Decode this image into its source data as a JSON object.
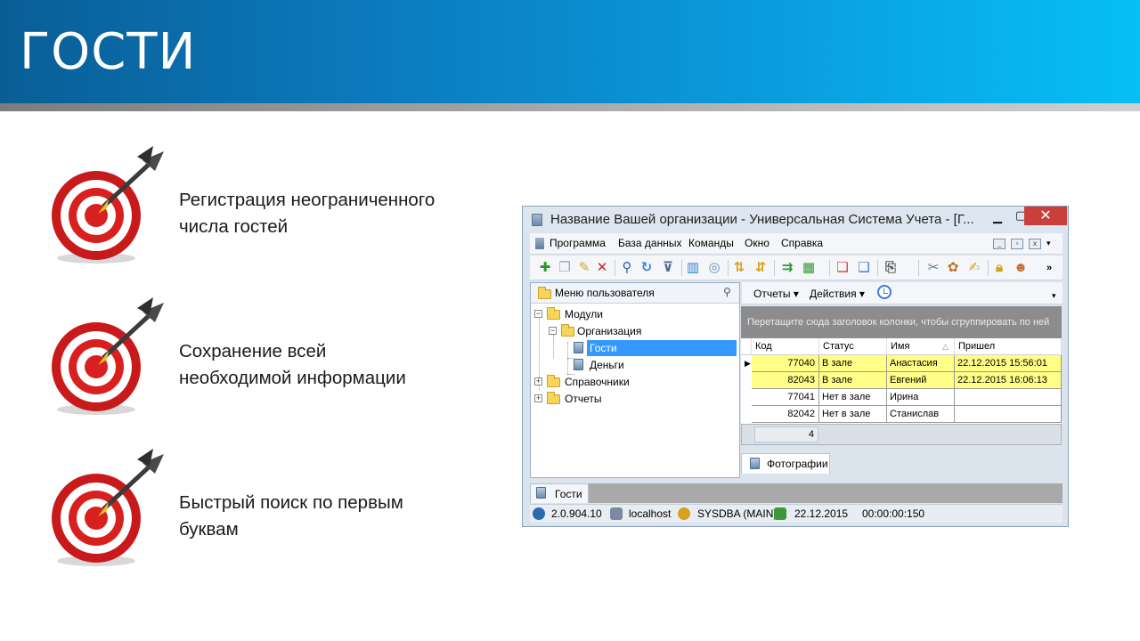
{
  "slide": {
    "title": "ГОСТИ",
    "features": [
      {
        "line1": "Регистрация неограниченного",
        "line2": "числа гостей"
      },
      {
        "line1": "Сохранение всей",
        "line2": "необходимой информации"
      },
      {
        "line1": "Быстрый поиск по первым",
        "line2": "буквам"
      }
    ]
  },
  "window": {
    "title": "Название Вашей организации - Универсальная Система Учета - [Г...",
    "menu": [
      "Программа",
      "База данных",
      "Команды",
      "Окно",
      "Справка"
    ],
    "left_panel": {
      "title": "Меню пользователя",
      "tree": {
        "modules": "Модули",
        "organization": "Организация",
        "guests": "Гости",
        "money": "Деньги",
        "directories": "Справочники",
        "reports": "Отчеты"
      }
    },
    "right_toolbar": {
      "reports": "Отчеты",
      "actions": "Действия"
    },
    "group_hint": "Перетащите сюда заголовок колонки, чтобы сгруппировать по ней",
    "grid": {
      "columns": [
        "Код",
        "Статус",
        "Имя",
        "Пришел"
      ],
      "rows": [
        {
          "code": "77040",
          "status": "В зале",
          "name": "Анастасия",
          "arrived": "22.12.2015 15:56:01"
        },
        {
          "code": "82043",
          "status": "В зале",
          "name": "Евгений",
          "arrived": "22.12.2015 16:06:13"
        },
        {
          "code": "77041",
          "status": "Нет в зале",
          "name": "Ирина",
          "arrived": ""
        },
        {
          "code": "82042",
          "status": "Нет в зале",
          "name": "Станислав",
          "arrived": ""
        }
      ],
      "footer_count": "4"
    },
    "photo_tab": "Фотографии",
    "bottom_tab": "Гости",
    "status": {
      "version": "2.0.904.10",
      "server": "localhost",
      "user": "SYSDBA (MAIN)",
      "date": "22.12.2015",
      "timer": "00:00:00:150"
    }
  },
  "colors": {
    "header_start": "#0a5e96",
    "header_end": "#06bff5",
    "row_highlight": "#ffff88",
    "selection": "#3399ff",
    "close_button": "#c9403a"
  }
}
